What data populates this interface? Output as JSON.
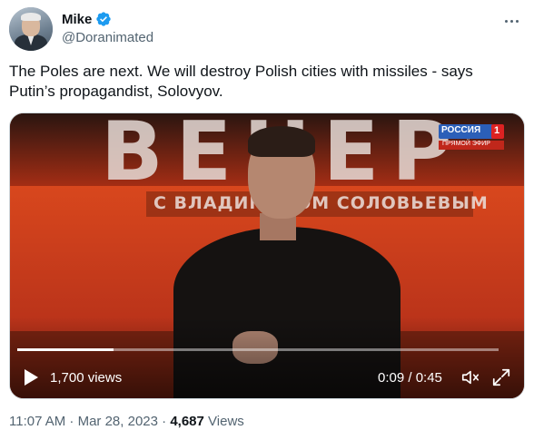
{
  "author": {
    "name": "Mike",
    "handle": "@Doranimated",
    "verified": true,
    "avatar_icon": "avatar-photo"
  },
  "tweet": {
    "text": "The Poles are next. We will destroy Polish cities with missiles - says Putin’s propagandist, Solovyov."
  },
  "video": {
    "scene_text": "ВЕЧЕР",
    "scene_subtitle": "С ВЛАДИМИРОМ СОЛОВЬЕВЫМ",
    "channel_logo": "РОССИЯ",
    "channel_number": "1",
    "channel_strip": "ПРЯМОЙ ЭФИР",
    "views": "1,700 views",
    "time": "0:09 / 0:45",
    "progress": 0.2,
    "icons": [
      "play-icon",
      "volume-icon",
      "fullscreen-icon"
    ]
  },
  "meta": {
    "timestamp": "11:07 AM · Mar 28, 2023",
    "separator": "·",
    "view_count": "4,687",
    "view_label": "Views"
  },
  "colors": {
    "verified_blue": "#1d9bf0",
    "text_primary": "#0f1419",
    "text_secondary": "#536471"
  }
}
